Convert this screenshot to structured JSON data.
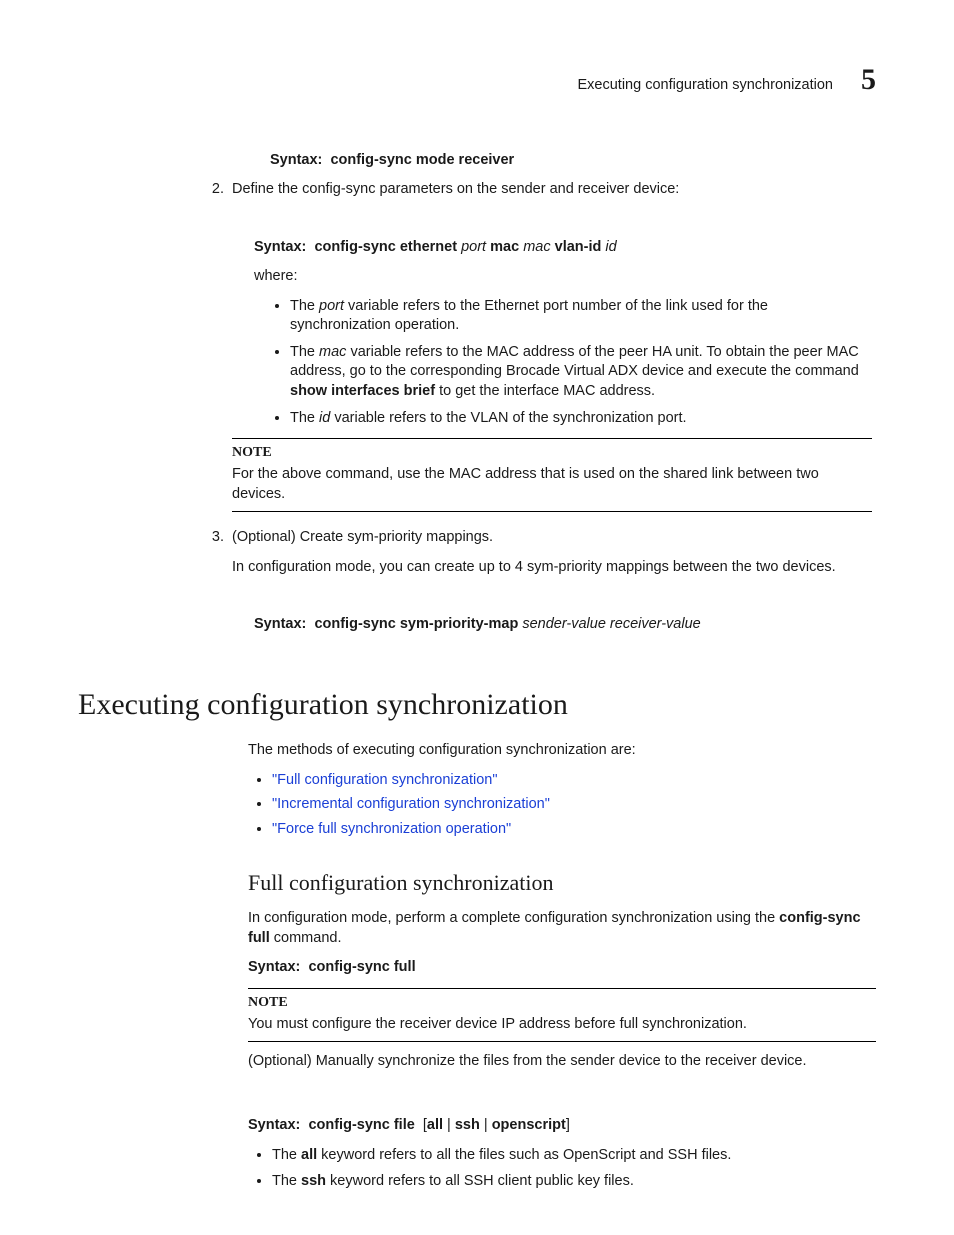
{
  "header": {
    "section_title": "Executing configuration synchronization",
    "chapter_number": "5"
  },
  "syntax_receiver": {
    "label": "Syntax:",
    "command": "config-sync mode receiver"
  },
  "step2": {
    "text": "Define the config-sync parameters on the sender and receiver device:"
  },
  "syntax_ethernet": {
    "label": "Syntax:",
    "cmd1": "config-sync ethernet",
    "var1": "port",
    "cmd2": "mac",
    "var2": "mac",
    "cmd3": "vlan-id",
    "var3": "id"
  },
  "where_label": "where:",
  "where_bullets": {
    "b1a": "The ",
    "b1b": "port",
    "b1c": " variable refers to the Ethernet port number of the link used for the synchronization operation.",
    "b2a": "The ",
    "b2b": "mac",
    "b2c": " variable refers to the MAC address of the peer HA unit. To obtain the peer MAC address, go to the corresponding Brocade Virtual ADX device and execute the command ",
    "b2d": "show interfaces brief",
    "b2e": " to get the interface MAC address.",
    "b3a": "The ",
    "b3b": "id",
    "b3c": " variable refers to the VLAN of the synchronization port."
  },
  "note1": {
    "title": "NOTE",
    "body": "For the above command, use the MAC address that is used on the shared link between two devices."
  },
  "step3": {
    "line1": "(Optional) Create sym-priority mappings.",
    "line2": "In configuration mode, you can create up to 4 sym-priority mappings between the two devices."
  },
  "syntax_sympri": {
    "label": "Syntax:",
    "cmd": "config-sync sym-priority-map",
    "vars": "sender-value receiver-value"
  },
  "h1": "Executing configuration synchronization",
  "intro_methods": "The methods of executing configuration synchronization are:",
  "method_links": {
    "l1": "\"Full configuration synchronization\"",
    "l2": "\"Incremental configuration synchronization\"",
    "l3": "\"Force full synchronization operation\""
  },
  "h2_full": "Full configuration synchronization",
  "full_para": {
    "a": "In configuration mode, perform a complete configuration synchronization using the ",
    "b": "config-sync full",
    "c": " command."
  },
  "syntax_full": {
    "label": "Syntax:",
    "cmd": "config-sync full"
  },
  "note2": {
    "title": "NOTE",
    "body": "You must configure the receiver device IP address before full synchronization."
  },
  "optional_sync": "(Optional) Manually synchronize the files from the sender device to the receiver device.",
  "syntax_file": {
    "label": "Syntax:",
    "cmd": "config-sync file",
    "options": "[all | ssh | openscript]"
  },
  "file_bullets": {
    "b1a": "The ",
    "b1b": "all",
    "b1c": " keyword refers to all the files such as OpenScript and SSH files.",
    "b2a": "The ",
    "b2b": "ssh",
    "b2c": " keyword refers to all SSH client public key files."
  }
}
